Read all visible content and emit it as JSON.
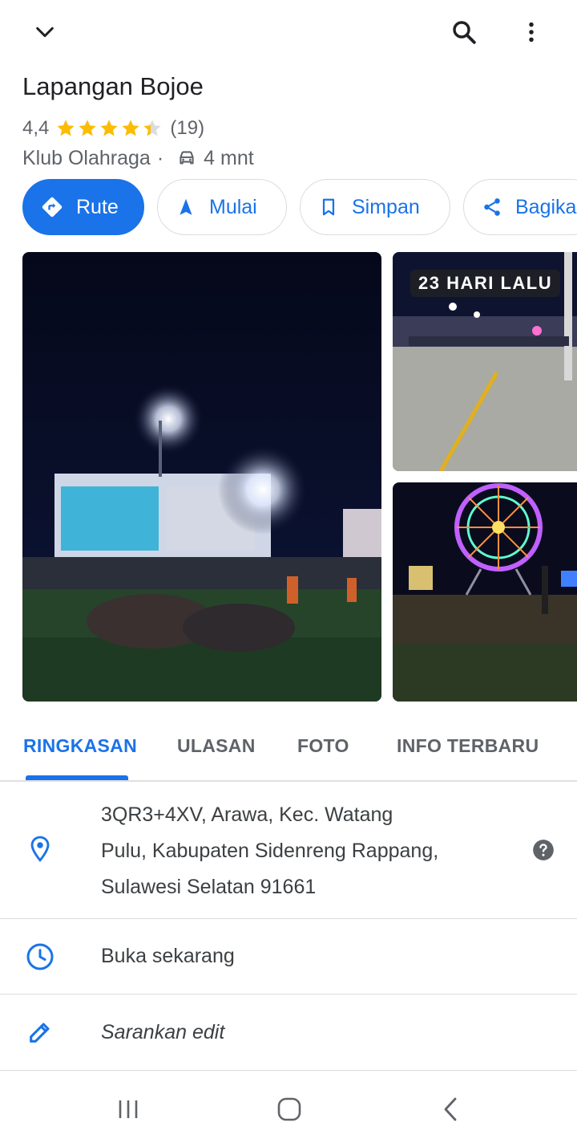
{
  "topbar": {
    "collapse_icon": "chevron-down-icon",
    "search_icon": "search-icon",
    "menu_icon": "more-vert-icon"
  },
  "place": {
    "name": "Lapangan Bojoe",
    "rating": "4,4",
    "stars_value": 4.4,
    "review_count": "(19)",
    "category": "Klub Olahraga",
    "separator": "·",
    "drive_time": "4 mnt"
  },
  "actions": [
    {
      "label": "Rute",
      "icon": "directions-icon"
    },
    {
      "label": "Mulai",
      "icon": "navigation-arrow-icon"
    },
    {
      "label": "Simpan",
      "icon": "bookmark-icon"
    },
    {
      "label": "Bagikan",
      "icon": "share-icon"
    }
  ],
  "photos": {
    "badge": "23 HARI LALU"
  },
  "tabs": [
    {
      "label": "RINGKASAN",
      "active": true
    },
    {
      "label": "ULASAN",
      "active": false
    },
    {
      "label": "FOTO",
      "active": false
    },
    {
      "label": "INFO TERBARU",
      "active": false
    }
  ],
  "info": {
    "address_lines": [
      "3QR3+4XV, Arawa, Kec. Watang",
      "Pulu, Kabupaten Sidenreng Rappang,",
      "Sulawesi Selatan 91661"
    ],
    "hours": "Buka sekarang",
    "suggest_edit": "Sarankan edit"
  },
  "colors": {
    "accent": "#1a73e8",
    "star": "#fbbc04",
    "text_secondary": "#5f6368"
  }
}
